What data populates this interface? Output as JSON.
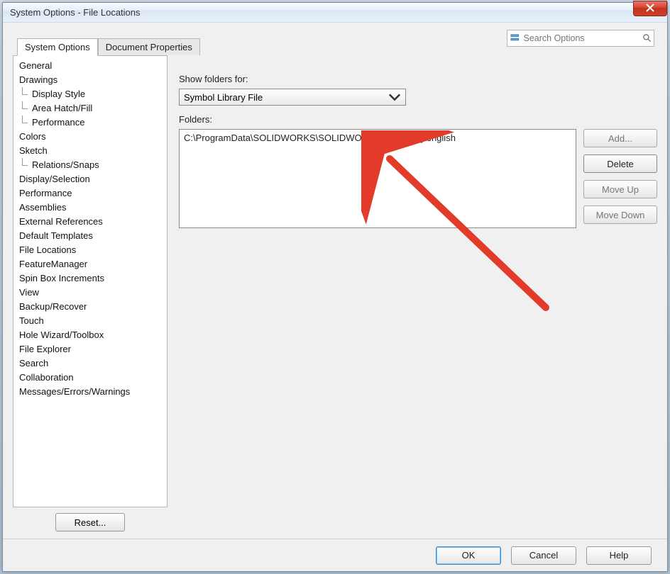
{
  "title": "System Options - File Locations",
  "search": {
    "placeholder": "Search Options"
  },
  "tabs": {
    "system_options": "System Options",
    "document_properties": "Document Properties"
  },
  "tree": [
    {
      "label": "General",
      "sub": false
    },
    {
      "label": "Drawings",
      "sub": false
    },
    {
      "label": "Display Style",
      "sub": true
    },
    {
      "label": "Area Hatch/Fill",
      "sub": true
    },
    {
      "label": "Performance",
      "sub": true
    },
    {
      "label": "Colors",
      "sub": false
    },
    {
      "label": "Sketch",
      "sub": false
    },
    {
      "label": "Relations/Snaps",
      "sub": true
    },
    {
      "label": "Display/Selection",
      "sub": false
    },
    {
      "label": "Performance",
      "sub": false
    },
    {
      "label": "Assemblies",
      "sub": false
    },
    {
      "label": "External References",
      "sub": false
    },
    {
      "label": "Default Templates",
      "sub": false
    },
    {
      "label": "File Locations",
      "sub": false
    },
    {
      "label": "FeatureManager",
      "sub": false
    },
    {
      "label": "Spin Box Increments",
      "sub": false
    },
    {
      "label": "View",
      "sub": false
    },
    {
      "label": "Backup/Recover",
      "sub": false
    },
    {
      "label": "Touch",
      "sub": false
    },
    {
      "label": "Hole Wizard/Toolbox",
      "sub": false
    },
    {
      "label": "File Explorer",
      "sub": false
    },
    {
      "label": "Search",
      "sub": false
    },
    {
      "label": "Collaboration",
      "sub": false
    },
    {
      "label": "Messages/Errors/Warnings",
      "sub": false
    }
  ],
  "labels": {
    "show_folders_for": "Show folders for:",
    "folders": "Folders:"
  },
  "dropdown_value": "Symbol Library File",
  "folder_path": "C:\\ProgramData\\SOLIDWORKS\\SOLIDWORKS 2015\\lang\\english",
  "buttons": {
    "add": "Add...",
    "delete": "Delete",
    "move_up": "Move Up",
    "move_down": "Move Down",
    "reset": "Reset...",
    "ok": "OK",
    "cancel": "Cancel",
    "help": "Help"
  }
}
